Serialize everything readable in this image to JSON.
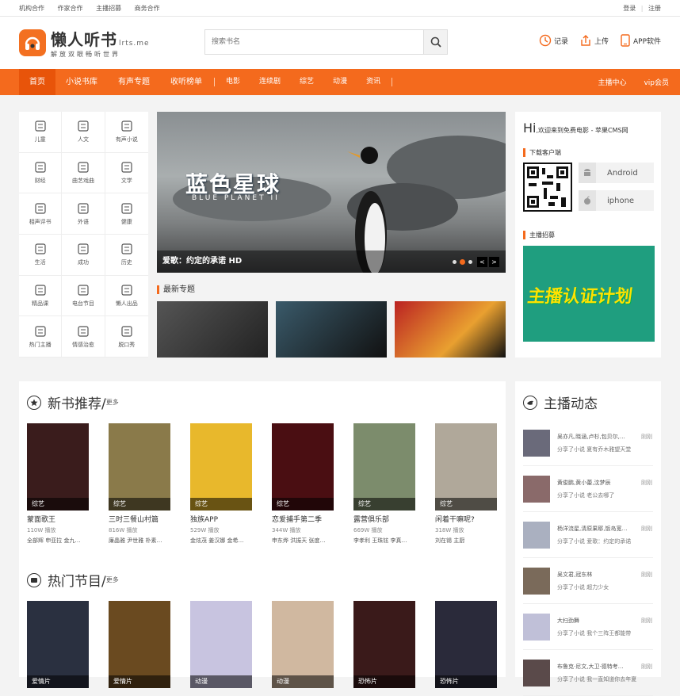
{
  "topbar": {
    "left": [
      "机构合作",
      "作家合作",
      "主播招募",
      "商务合作"
    ],
    "login": "登录",
    "sep": "|",
    "register": "注册"
  },
  "header": {
    "logo_title": "懒人听书",
    "logo_domain": "lrts.me",
    "logo_slogan": "解放双眼畅听世界",
    "search_placeholder": "搜索书名",
    "links": [
      "记录",
      "上传",
      "APP软件"
    ]
  },
  "nav": {
    "items": [
      "首页",
      "小说书库",
      "有声专题",
      "收听榜单"
    ],
    "sub": [
      "电影",
      "连续剧",
      "综艺",
      "动漫",
      "资讯"
    ],
    "right": [
      "主播中心",
      "vip会员"
    ]
  },
  "categories": [
    "儿童",
    "人文",
    "有声小说",
    "财经",
    "曲艺戏曲",
    "文学",
    "相声评书",
    "外语",
    "健康",
    "生活",
    "成功",
    "历史",
    "精品课",
    "电台节目",
    "懒人出品",
    "热门主播",
    "情感治愈",
    "脱口秀"
  ],
  "banner": {
    "caption": "爱歌：约定的承诺 HD",
    "title": "蓝色星球",
    "subtitle": "BLUE PLANET II",
    "arrows": [
      "<",
      ">"
    ]
  },
  "latest_title": "最新专题",
  "side": {
    "hi": "Hi",
    "welcome": ",欢迎来到免费电影 - 苹果CMS网",
    "download_title": "下载客户端",
    "android": "Android",
    "iphone": "iphone",
    "recruit_title": "主播招募",
    "promo_text": "主播认证计划"
  },
  "newbooks": {
    "title": "新书推荐/",
    "more": "更多",
    "items": [
      {
        "title": "蒙面歌王",
        "plays": "110W 播放",
        "cast": "全部辉 申亚拉 金九…",
        "tag": "综艺",
        "color": "#3a1c1c"
      },
      {
        "title": "三时三餐山村篇",
        "plays": "816W 播放",
        "cast": "廉晶雅 尹世雅 朴素…",
        "tag": "综艺",
        "color": "#8a7a4a"
      },
      {
        "title": "独族APP",
        "plays": "529W 播放",
        "cast": "金炫茂 姜汉娜 金希…",
        "tag": "综艺",
        "color": "#e8b82c"
      },
      {
        "title": "恋爱捕手第二季",
        "plays": "344W 播放",
        "cast": "申东烨 洪振天 张度…",
        "tag": "综艺",
        "color": "#4a0e12"
      },
      {
        "title": "露营俱乐部",
        "plays": "669W 播放",
        "cast": "李孝利 王珠铉 李真…",
        "tag": "综艺",
        "color": "#7c8c6c"
      },
      {
        "title": "闲着干嘛呢?",
        "plays": "318W 播放",
        "cast": "刘在锡 主厨",
        "tag": "综艺",
        "color": "#b0a89a"
      }
    ]
  },
  "hot": {
    "title": "热门节目/",
    "more": "更多",
    "items": [
      {
        "tag": "爱情片",
        "color": "#2a3040"
      },
      {
        "tag": "爱情片",
        "color": "#6a4a20"
      },
      {
        "tag": "动漫",
        "color": "#c8c4e0"
      },
      {
        "tag": "动漫",
        "color": "#d0b8a0"
      },
      {
        "tag": "恐怖片",
        "color": "#3a1a1a"
      },
      {
        "tag": "恐怖片",
        "color": "#2a2a3a"
      }
    ]
  },
  "anchor": {
    "title": "主播动态",
    "rows": [
      {
        "names": "吴亦凡,晓涵,卢杉,包贝尔,…",
        "time": "刚刚",
        "share": "分享了小说",
        "work": "夏有乔木雅望天堂"
      },
      {
        "names": "黄俊鹏,黄小蕾,沈梦辰",
        "time": "刚刚",
        "share": "分享了小说",
        "work": "老公去哪了"
      },
      {
        "names": "杨洋流星,清原果耶,饭岛宽…",
        "time": "刚刚",
        "share": "分享了小说",
        "work": "爱歌：约定的承诺"
      },
      {
        "names": "吴文君,冠东林",
        "time": "刚刚",
        "share": "分享了小说",
        "work": "超力少女"
      },
      {
        "names": "大扫劲舞",
        "time": "刚刚",
        "share": "分享了小说",
        "work": "我个三阵王都能带"
      },
      {
        "names": "布鲁克·尼文,大卫·德特考…",
        "time": "刚刚",
        "share": "分享了小说",
        "work": "我一直知道你去年夏"
      }
    ]
  },
  "colors": {
    "accent": "#f46a1d"
  }
}
